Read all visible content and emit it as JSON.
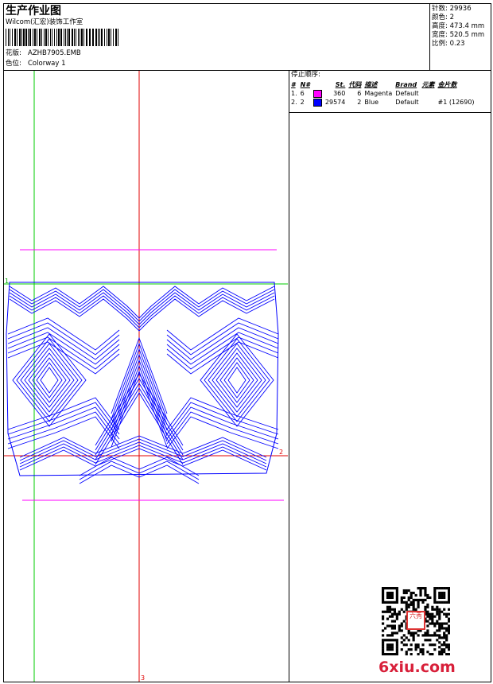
{
  "header": {
    "title": "生产作业图",
    "company": "Wilcom(汇宏)装饰工作室",
    "design_label": "花版:",
    "design_value": "AZHB7905.EMB",
    "colorway_label": "色位:",
    "colorway_value": "Colorway 1"
  },
  "stats": [
    {
      "label": "针数:",
      "value": "29936"
    },
    {
      "label": "颜色:",
      "value": "2"
    },
    {
      "label": "高度:",
      "value": "473.4 mm"
    },
    {
      "label": "宽度:",
      "value": "520.5 mm"
    },
    {
      "label": "比例:",
      "value": "0.23"
    }
  ],
  "stop_sequence": {
    "heading": "停止顺序:",
    "columns": [
      "#",
      "N#",
      "St.",
      "代码",
      "描述",
      "Brand",
      "元素",
      "金片数"
    ],
    "rows": [
      {
        "num": "1.",
        "n": "6",
        "color": "#ff00ff",
        "st": "360",
        "code": "6",
        "desc": "Magenta",
        "brand": "Default",
        "elements": "",
        "sequins": ""
      },
      {
        "num": "2.",
        "n": "2",
        "color": "#0000ff",
        "st": "29574",
        "code": "2",
        "desc": "Blue",
        "brand": "Default",
        "elements": "",
        "sequins": "#1 (12690)"
      }
    ]
  },
  "markers": {
    "m1": "1",
    "m2": "2",
    "m3": "3"
  },
  "watermark": {
    "site": "6xiu.com",
    "stamp": "六秀"
  },
  "colors": {
    "magenta": "#ff00ff",
    "blue": "#0000ff",
    "red": "#e00000",
    "green": "#00cc00"
  }
}
